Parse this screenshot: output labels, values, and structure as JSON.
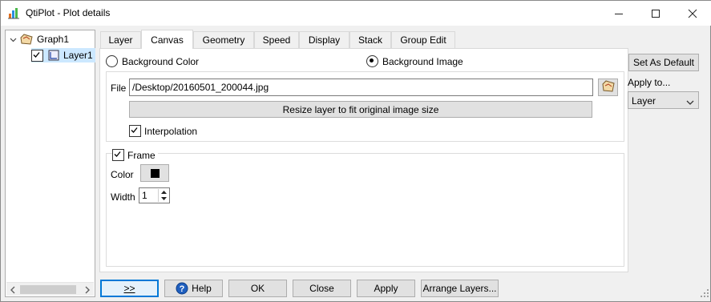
{
  "window": {
    "title": "QtiPlot - Plot details"
  },
  "tree": {
    "items": [
      {
        "label": "Graph1",
        "expanded": true
      },
      {
        "label": "Layer1",
        "checked": true
      }
    ]
  },
  "tabs": [
    {
      "label": "Layer"
    },
    {
      "label": "Canvas",
      "active": true
    },
    {
      "label": "Geometry"
    },
    {
      "label": "Speed"
    },
    {
      "label": "Display"
    },
    {
      "label": "Stack"
    },
    {
      "label": "Group Edit"
    }
  ],
  "canvas": {
    "bg_color_label": "Background Color",
    "bg_image_label": "Background Image",
    "bg_mode": "image",
    "file_label": "File",
    "file_value": "/Desktop/20160501_200044.jpg",
    "resize_button": "Resize layer to fit original image size",
    "interpolation_label": "Interpolation",
    "interpolation_checked": true,
    "frame_label": "Frame",
    "frame_checked": true,
    "color_label": "Color",
    "frame_color": "#000000",
    "width_label": "Width",
    "width_value": "1"
  },
  "side": {
    "set_default_button": "Set As Default",
    "apply_to_label": "Apply to...",
    "apply_to_value": "Layer"
  },
  "bottom": {
    "expand_button": ">>",
    "help_button": "Help",
    "ok_button": "OK",
    "close_button": "Close",
    "apply_button": "Apply",
    "arrange_button": "Arrange Layers..."
  }
}
